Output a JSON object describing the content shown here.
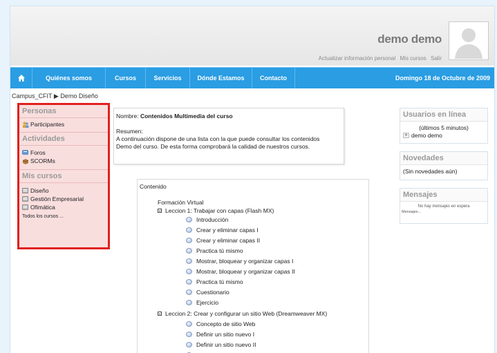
{
  "header": {
    "username": "demo demo",
    "links": [
      "Actualizar información personal",
      "Mis cursos",
      "Salir"
    ]
  },
  "nav": {
    "items": [
      "Quiénes somos",
      "Cursos",
      "Servicios",
      "Dónde Estamos",
      "Contacto"
    ],
    "date": "Domingo 18 de Octubre de 2009"
  },
  "breadcrumb": {
    "root": "Campus_CFIT",
    "separator": "▶",
    "current": "Demo Diseño"
  },
  "left": {
    "personas_title": "Personas",
    "personas_items": [
      "Participantes"
    ],
    "actividades_title": "Actividades",
    "actividades_items": [
      "Foros",
      "SCORMs"
    ],
    "cursos_title": "Mis cursos",
    "cursos_items": [
      "Diseño",
      "Gestión Empresarial",
      "Ofimática"
    ],
    "all_courses": "Todos los cursos ..."
  },
  "summary": {
    "name_label": "Nombre:",
    "name_value": "Contenidos Multimedia del curso",
    "summary_label": "Resumen:",
    "summary_line1": "A continuación dispone de una lista con la que puede consultar los contenidos",
    "summary_line2": "Demo del curso. De esta forma comprobará la calidad de nuestros cursos."
  },
  "content": {
    "title": "Contenido",
    "root": "Formación Virtual",
    "lesson1": "Leccion 1: Trabajar con capas (Flash MX)",
    "lesson1_items": [
      "Introducción",
      "Crear y eliminar capas I",
      "Crear y eliminar capas II",
      "Practica tú mismo",
      "Mostrar, bloquear y organizar capas I",
      "Mostrar, bloquear y organizar capas II",
      "Practica tú mismo",
      "Cuestionario",
      "Ejercicio"
    ],
    "lesson2": "Leccion 2: Crear y configurar un sitio Web (Dreamweaver MX)",
    "lesson2_items": [
      "Concepto de sitio Web",
      "Definir un sitio nuevo I",
      "Definir un sitio nuevo II",
      "Definir un sitio nuevo III"
    ]
  },
  "right": {
    "online_title": "Usuarios en línea",
    "online_sub": "(últimos 5 minutos)",
    "online_user": "demo demo",
    "news_title": "Novedades",
    "news_empty": "(Sin novedades aún)",
    "messages_title": "Mensajes",
    "messages_empty": "No hay mensajes en espera",
    "messages_link": "Mensajes..."
  },
  "colors": {
    "nav": "#2a9de3",
    "highlight": "#e0201e",
    "highlight_bg": "#f9dede"
  }
}
